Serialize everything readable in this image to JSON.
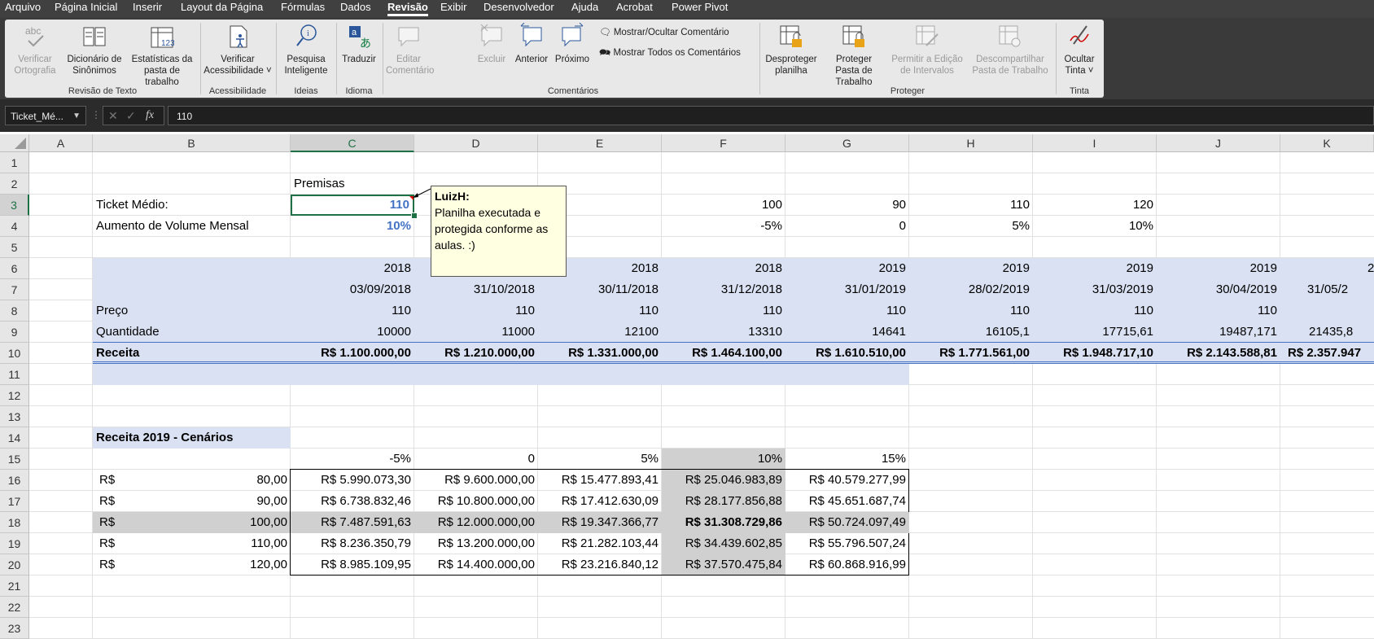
{
  "menu": [
    "Arquivo",
    "Página Inicial",
    "Inserir",
    "Layout da Página",
    "Fórmulas",
    "Dados",
    "Revisão",
    "Exibir",
    "Desenvolvedor",
    "Ajuda",
    "Acrobat",
    "Power Pivot"
  ],
  "ribbon": {
    "groups": {
      "revisao_texto": "Revisão de Texto",
      "acessibilidade": "Acessibilidade",
      "ideias": "Ideias",
      "idioma": "Idioma",
      "comentarios": "Comentários",
      "proteger": "Proteger",
      "tinta": "Tinta"
    },
    "buttons": {
      "verificar_ortografia": "Verificar Ortografia",
      "dicionario": "Dicionário de Sinônimos",
      "estatisticas": "Estatísticas da pasta de trabalho",
      "verificar_acessibilidade": "Verificar Acessibilidade ˅",
      "pesquisa": "Pesquisa Inteligente",
      "traduzir": "Traduzir",
      "editar_comentario": "Editar Comentário",
      "excluir": "Excluir",
      "anterior": "Anterior",
      "proximo": "Próximo",
      "mostrar_ocultar": "Mostrar/Ocultar Comentário",
      "mostrar_todos": "Mostrar Todos os Comentários",
      "desproteger": "Desproteger planilha",
      "proteger_pasta": "Proteger Pasta de Trabalho",
      "permitir_edicao": "Permitir a Edição de Intervalos",
      "descompartilhar": "Descompartilhar Pasta de Trabalho",
      "ocultar_tinta": "Ocultar Tinta ˅"
    }
  },
  "formula_bar": {
    "name_box": "Ticket_Mé...",
    "formula": "110"
  },
  "columns": [
    "A",
    "B",
    "C",
    "D",
    "E",
    "F",
    "G",
    "H",
    "I",
    "J",
    "K"
  ],
  "rows": [
    "1",
    "2",
    "3",
    "4",
    "5",
    "6",
    "7",
    "8",
    "9",
    "10",
    "11",
    "12",
    "13",
    "14",
    "15",
    "16",
    "17",
    "18",
    "19",
    "20",
    "21",
    "22",
    "23"
  ],
  "sheet": {
    "premisas": "Premisas",
    "ticket_label": "Ticket Médio:",
    "ticket_value": "110",
    "aumento_label": "Aumento de Volume Mensal",
    "aumento_value": "10%",
    "row3": {
      "F": "100",
      "G": "90",
      "H": "110",
      "I": "120"
    },
    "row4": {
      "F": "-5%",
      "G": "0",
      "H": "5%",
      "I": "10%"
    },
    "years": {
      "C": "2018",
      "E": "2018",
      "F": "2018",
      "G": "2019",
      "H": "2019",
      "I": "2019",
      "J": "2019",
      "K": "2"
    },
    "dates": {
      "C": "03/09/2018",
      "D": "31/10/2018",
      "E": "30/11/2018",
      "F": "31/12/2018",
      "G": "31/01/2019",
      "H": "28/02/2019",
      "I": "31/03/2019",
      "J": "30/04/2019",
      "K": "31/05/2"
    },
    "preco_label": "Preço",
    "preco": {
      "C": "110",
      "D": "110",
      "E": "110",
      "F": "110",
      "G": "110",
      "H": "110",
      "I": "110",
      "J": "110"
    },
    "quantidade_label": "Quantidade",
    "quantidade": {
      "C": "10000",
      "D": "11000",
      "E": "12100",
      "F": "13310",
      "G": "14641",
      "H": "16105,1",
      "I": "17715,61",
      "J": "19487,171",
      "K": "21435,8"
    },
    "receita_label": "Receita",
    "receita": {
      "C": "R$ 1.100.000,00",
      "D": "R$ 1.210.000,00",
      "E": "R$ 1.331.000,00",
      "F": "R$ 1.464.100,00",
      "G": "R$ 1.610.510,00",
      "H": "R$ 1.771.561,00",
      "I": "R$ 1.948.717,10",
      "J": "R$ 2.143.588,81",
      "K": "R$ 2.357.947"
    },
    "cenarios_title": "Receita 2019 - Cenários",
    "cenarios_headers": [
      "-5%",
      "0",
      "5%",
      "10%",
      "15%"
    ],
    "cenarios_rows": [
      {
        "cur": "R$",
        "val": "80,00",
        "cells": [
          "R$ 5.990.073,30",
          "R$ 9.600.000,00",
          "R$ 15.477.893,41",
          "R$ 25.046.983,89",
          "R$ 40.579.277,99"
        ]
      },
      {
        "cur": "R$",
        "val": "90,00",
        "cells": [
          "R$ 6.738.832,46",
          "R$ 10.800.000,00",
          "R$ 17.412.630,09",
          "R$ 28.177.856,88",
          "R$ 45.651.687,74"
        ]
      },
      {
        "cur": "R$",
        "val": "100,00",
        "cells": [
          "R$ 7.487.591,63",
          "R$ 12.000.000,00",
          "R$ 19.347.366,77",
          "R$ 31.308.729,86",
          "R$ 50.724.097,49"
        ]
      },
      {
        "cur": "R$",
        "val": "110,00",
        "cells": [
          "R$ 8.236.350,79",
          "R$ 13.200.000,00",
          "R$ 21.282.103,44",
          "R$ 34.439.602,85",
          "R$ 55.796.507,24"
        ]
      },
      {
        "cur": "R$",
        "val": "120,00",
        "cells": [
          "R$ 8.985.109,95",
          "R$ 14.400.000,00",
          "R$ 23.216.840,12",
          "R$ 37.570.475,84",
          "R$ 60.868.916,99"
        ]
      }
    ]
  },
  "comment": {
    "author": "LuizH:",
    "text": "Planilha executada e protegida conforme as aulas. :)"
  }
}
